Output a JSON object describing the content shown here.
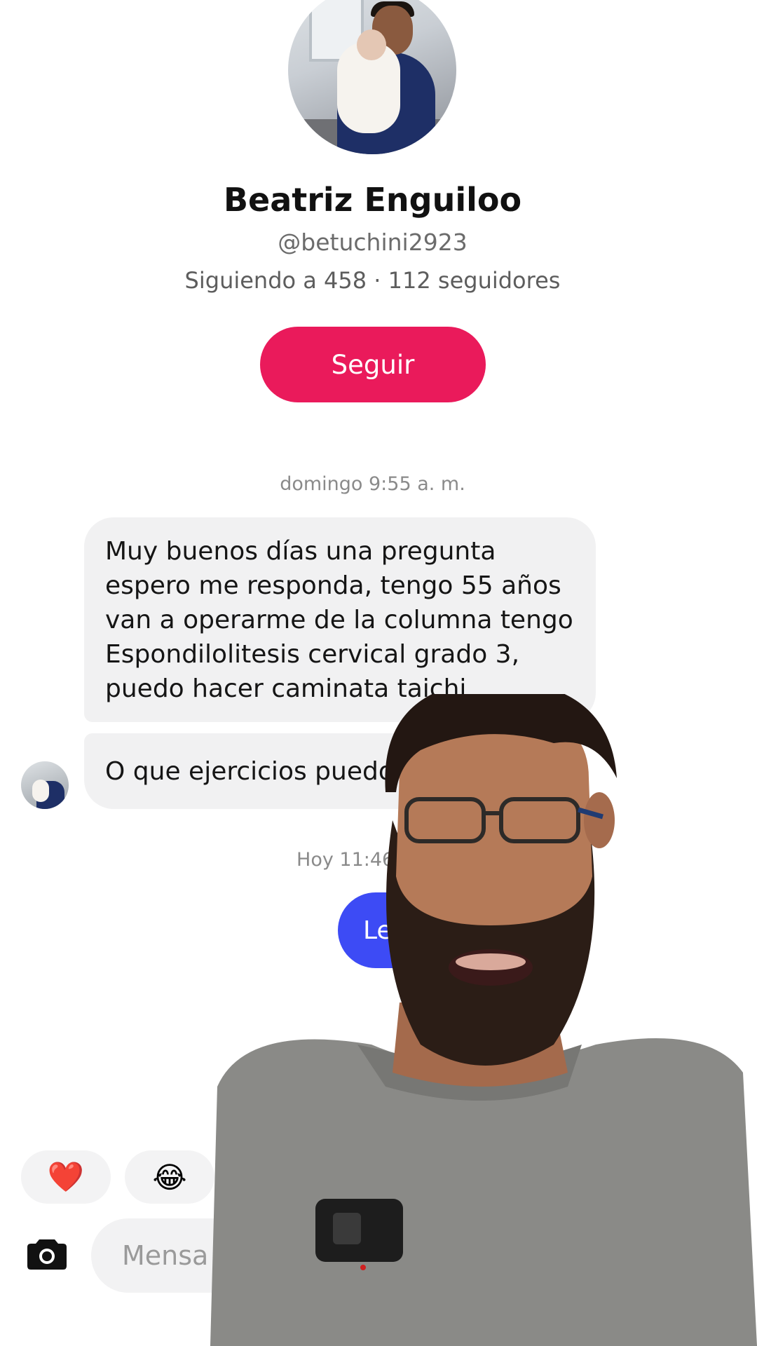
{
  "profile": {
    "name": "Beatriz Enguiloo",
    "handle": "@betuchini2923",
    "stats": "Siguiendo a 458 · 112 seguidores",
    "follow_label": "Seguir"
  },
  "chat": {
    "timestamp_1": "domingo 9:55 a. m.",
    "incoming_1_lines": [
      "Muy buenos días una pregunta",
      "espero me responda, tengo 55 años",
      "van a operarme de la columna tengo",
      "Espondilolitesis cervical grado 3,",
      "puedo hacer caminata taichi"
    ],
    "incoming_2": "O que ejercicios puedo hace",
    "timestamp_2": "Hoy 11:46 p. m.",
    "outgoing_1": "Le respo"
  },
  "reactions": {
    "heart": "❤️",
    "laugh": "😂"
  },
  "composer": {
    "placeholder": "Mensa"
  },
  "colors": {
    "follow_button": "#ea1a5b",
    "outgoing_bubble": "#3d4bf5",
    "incoming_bubble": "#f1f1f2"
  }
}
